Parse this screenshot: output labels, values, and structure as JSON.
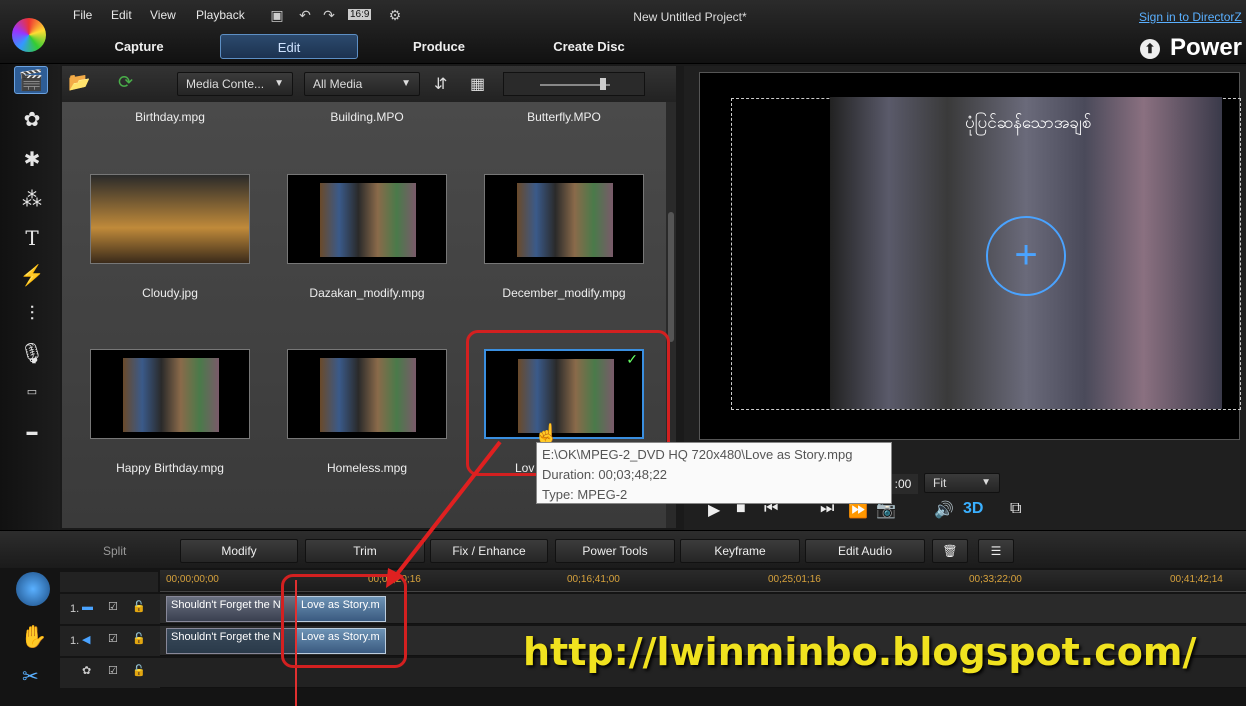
{
  "menu": {
    "file": "File",
    "edit": "Edit",
    "view": "View",
    "playback": "Playback",
    "aspect": "16:9"
  },
  "window_title": "New Untitled Project*",
  "signin": "Sign in to DirectorZ",
  "modes": [
    "Capture",
    "Edit",
    "Produce",
    "Create Disc"
  ],
  "active_mode": "Edit",
  "brand": "Power",
  "toolbar": {
    "media_content": "Media Conte...",
    "all_media": "All Media"
  },
  "library": {
    "row0": [
      "Birthday.mpg",
      "Building.MPO",
      "Butterfly.MPO"
    ],
    "row1": [
      "Cloudy.jpg",
      "Dazakan_modify.mpg",
      "December_modify.mpg"
    ],
    "row2": [
      "Happy Birthday.mpg",
      "Homeless.mpg",
      "Lov"
    ],
    "selected": "Love as Story.mpg"
  },
  "preview": {
    "burmese_title": "ပုံပြင်ဆန်သောအချစ်",
    "zoom": "Fit",
    "timecode": ":00"
  },
  "tooltip": {
    "path": "E:\\OK\\MPEG-2_DVD HQ 720x480\\Love as Story.mpg",
    "duration": "Duration: 00;03;48;22",
    "type": "Type: MPEG-2"
  },
  "editbar": [
    "Split",
    "Modify",
    "Trim",
    "Fix / Enhance",
    "Power Tools",
    "Keyframe",
    "Edit Audio"
  ],
  "ruler": [
    "00;00;00;00",
    "00;0?;20;16",
    "00;16;41;00",
    "00;25;01;16",
    "00;33;22;00",
    "00;41;42;14"
  ],
  "tracks": {
    "video_num": "1.",
    "audio_num": "1.",
    "clip1": "Shouldn't Forget the N",
    "clip2": "Love as Story.m",
    "clip1_audio": "Shouldn't Forget the N",
    "clip2_audio": "Love as Story.m"
  },
  "watermark": "http://lwinminbo.blogspot.com/"
}
